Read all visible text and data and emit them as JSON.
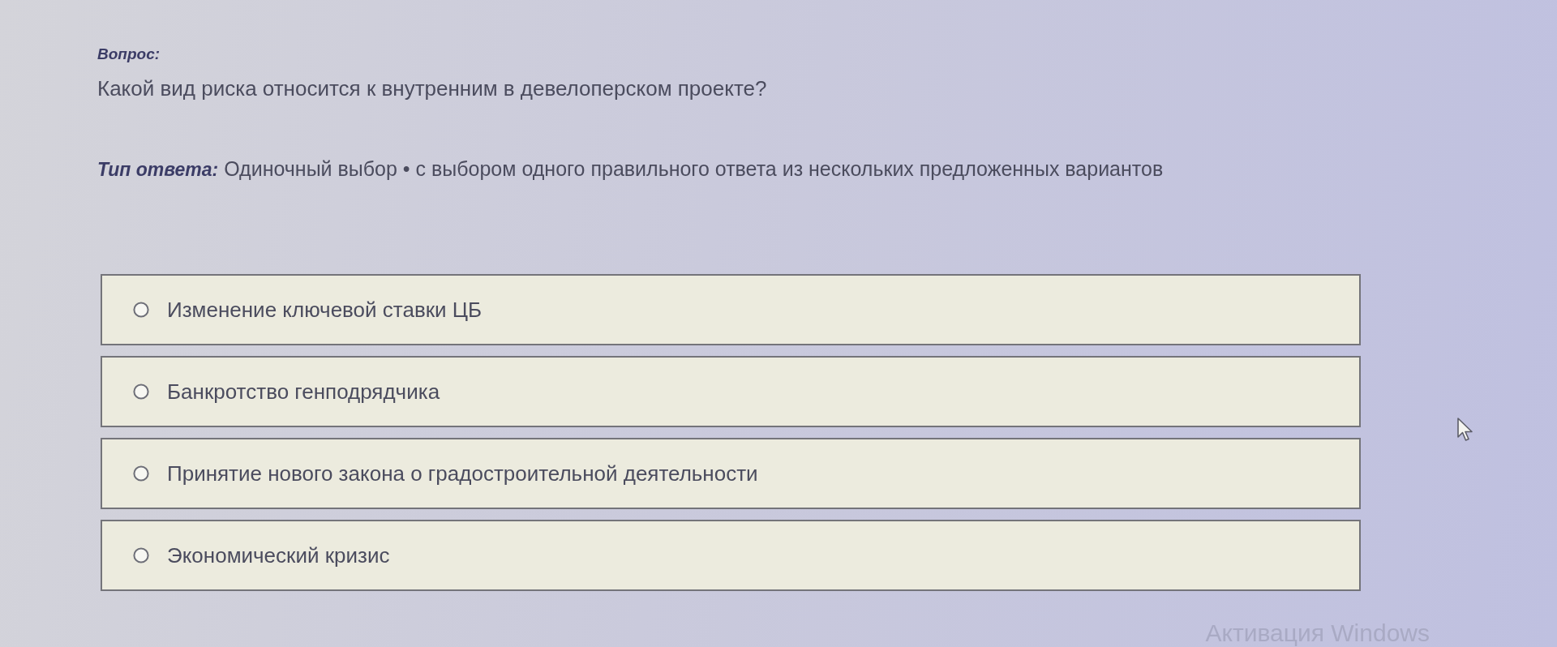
{
  "question": {
    "heading": "Вопрос:",
    "text": "Какой вид риска относится к внутренним в девелоперском проекте?"
  },
  "answer_type": {
    "label": "Тип ответа:",
    "value": "Одиночный выбор • с выбором одного правильного ответа из нескольких предложенных вариантов"
  },
  "options": [
    {
      "label": "Изменение ключевой ставки ЦБ",
      "selected": false
    },
    {
      "label": "Банкротство генподрядчика",
      "selected": false
    },
    {
      "label": "Принятие нового закона о градостроительной деятельности",
      "selected": false
    },
    {
      "label": "Экономический кризис",
      "selected": false
    }
  ],
  "system_overlay": {
    "text": "Активация Windows"
  }
}
